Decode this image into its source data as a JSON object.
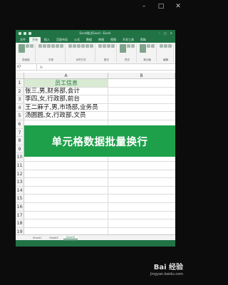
{
  "window_controls": {
    "minimize": "–",
    "maximize": "□",
    "close": "✕"
  },
  "excel": {
    "title": "Excel批注Excel - Excel",
    "ribbon_tabs": [
      {
        "label": "文件"
      },
      {
        "label": "开始"
      },
      {
        "label": "插入"
      },
      {
        "label": "页面布局"
      },
      {
        "label": "公式"
      },
      {
        "label": "数据"
      },
      {
        "label": "审阅"
      },
      {
        "label": "视图"
      },
      {
        "label": "开发工具"
      },
      {
        "label": "帮助"
      }
    ],
    "active_tab": "开始",
    "ribbon_groups": [
      {
        "label": "剪贴板"
      },
      {
        "label": "字体"
      },
      {
        "label": "对齐方式"
      },
      {
        "label": "数字"
      },
      {
        "label": "样式"
      },
      {
        "label": "单元格"
      },
      {
        "label": "编辑"
      }
    ],
    "name_box": "A7",
    "fx": "fx",
    "columns": [
      "A",
      "B"
    ],
    "rows": [
      {
        "n": "1",
        "a": "员工信息"
      },
      {
        "n": "2",
        "a": "张三,男,财务部,会计"
      },
      {
        "n": "3",
        "a": "李四,女,行政部,前台"
      },
      {
        "n": "4",
        "a": "王二麻子,男,市场部,业务员"
      },
      {
        "n": "5",
        "a": "汤圆圆,女,行政部,文员"
      },
      {
        "n": "6",
        "a": ""
      },
      {
        "n": "7",
        "a": ""
      },
      {
        "n": "8",
        "a": ""
      },
      {
        "n": "9",
        "a": ""
      },
      {
        "n": "10",
        "a": ""
      },
      {
        "n": "11",
        "a": ""
      },
      {
        "n": "12",
        "a": ""
      },
      {
        "n": "13",
        "a": ""
      },
      {
        "n": "14",
        "a": ""
      },
      {
        "n": "15",
        "a": ""
      },
      {
        "n": "16",
        "a": ""
      },
      {
        "n": "17",
        "a": ""
      },
      {
        "n": "18",
        "a": ""
      },
      {
        "n": "19",
        "a": ""
      },
      {
        "n": "20",
        "a": ""
      }
    ],
    "sheets": [
      {
        "label": "Sheet1"
      },
      {
        "label": "Sheet2"
      },
      {
        "label": "Sheet3"
      }
    ],
    "active_sheet": "Sheet3"
  },
  "banner_text": "单元格数据批量换行",
  "watermark": {
    "brand": "Bai 经验",
    "url": "jingyan.baidu.com"
  },
  "colors": {
    "excel_green": "#217346",
    "banner_green": "#1ea04a",
    "header_fill": "#d9ead3"
  }
}
